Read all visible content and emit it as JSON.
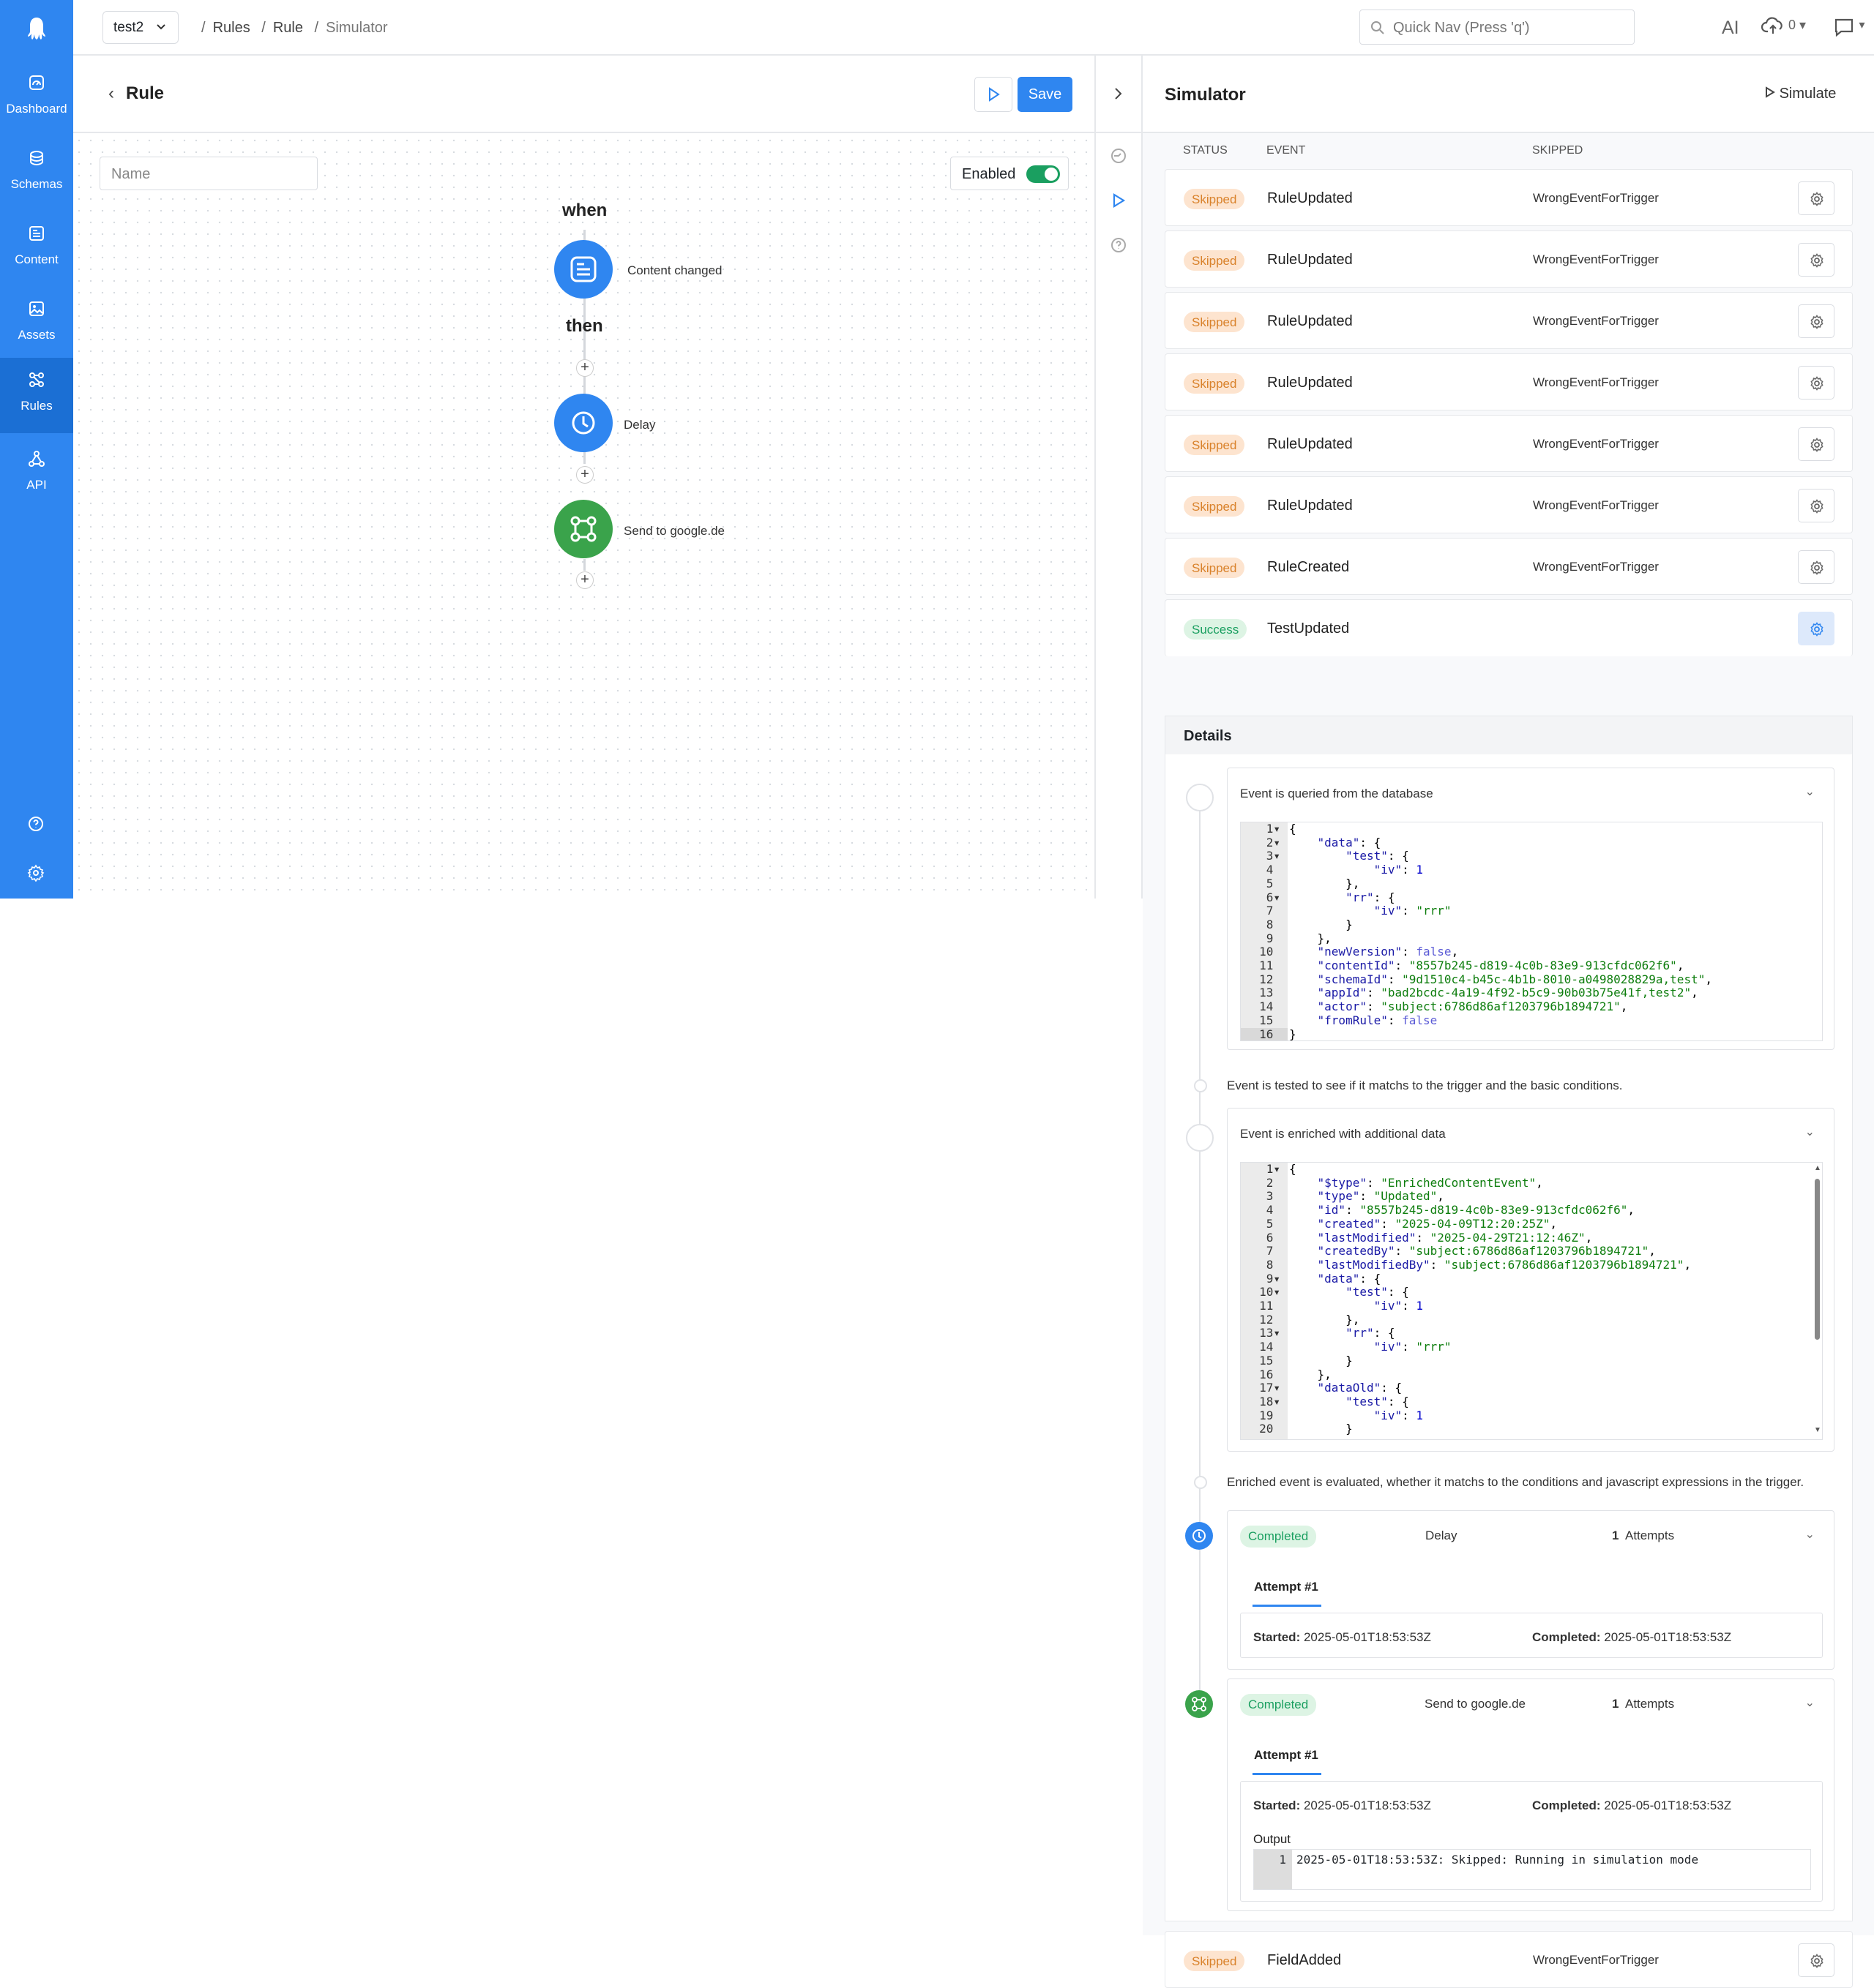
{
  "nav": {
    "items": [
      {
        "label": "Dashboard",
        "icon": "dashboard-icon"
      },
      {
        "label": "Schemas",
        "icon": "database-icon"
      },
      {
        "label": "Content",
        "icon": "content-icon"
      },
      {
        "label": "Assets",
        "icon": "image-icon"
      },
      {
        "label": "Rules",
        "icon": "rules-icon",
        "active": true
      },
      {
        "label": "API",
        "icon": "api-icon"
      }
    ]
  },
  "topbar": {
    "app": "test2",
    "breadcrumbs": [
      "Rules",
      "Rule",
      "Simulator"
    ],
    "quicknav_placeholder": "Quick Nav (Press 'q')",
    "ai": "AI",
    "upload_count": "0"
  },
  "rule": {
    "title": "Rule",
    "save_label": "Save",
    "name_placeholder": "Name",
    "enabled_label": "Enabled",
    "when_label": "when",
    "then_label": "then",
    "trigger_label": "Content changed",
    "steps": [
      "Delay",
      "Send to google.de"
    ]
  },
  "simulator": {
    "title": "Simulator",
    "simulate_label": "Simulate",
    "columns": [
      "STATUS",
      "EVENT",
      "SKIPPED"
    ],
    "events": [
      {
        "status": "Skipped",
        "event": "RuleUpdated",
        "skipped": "WrongEventForTrigger"
      },
      {
        "status": "Skipped",
        "event": "RuleUpdated",
        "skipped": "WrongEventForTrigger"
      },
      {
        "status": "Skipped",
        "event": "RuleUpdated",
        "skipped": "WrongEventForTrigger"
      },
      {
        "status": "Skipped",
        "event": "RuleUpdated",
        "skipped": "WrongEventForTrigger"
      },
      {
        "status": "Skipped",
        "event": "RuleUpdated",
        "skipped": "WrongEventForTrigger"
      },
      {
        "status": "Skipped",
        "event": "RuleUpdated",
        "skipped": "WrongEventForTrigger"
      },
      {
        "status": "Skipped",
        "event": "RuleCreated",
        "skipped": "WrongEventForTrigger"
      },
      {
        "status": "Success",
        "event": "TestUpdated",
        "skipped": ""
      }
    ],
    "last_event": {
      "status": "Skipped",
      "event": "FieldAdded",
      "skipped": "WrongEventForTrigger"
    },
    "details": {
      "title": "Details",
      "step1": "Event is queried from the database",
      "step2": "Event is tested to see if it matchs to the trigger and the basic conditions.",
      "step3": "Event is enriched with additional data",
      "step4": "Enriched event is evaluated, whether it matchs to the conditions and javascript expressions in the trigger.",
      "code1": [
        "{",
        "    \"data\": {",
        "        \"test\": {",
        "            \"iv\": 1",
        "        },",
        "        \"rr\": {",
        "            \"iv\": \"rrr\"",
        "        }",
        "    },",
        "    \"newVersion\": false,",
        "    \"contentId\": \"8557b245-d819-4c0b-83e9-913cfdc062f6\",",
        "    \"schemaId\": \"9d1510c4-b45c-4b1b-8010-a0498028829a,test\",",
        "    \"appId\": \"bad2bcdc-4a19-4f92-b5c9-90b03b75e41f,test2\",",
        "    \"actor\": \"subject:6786d86af1203796b1894721\",",
        "    \"fromRule\": false",
        "}"
      ],
      "code2": [
        "{",
        "    \"$type\": \"EnrichedContentEvent\",",
        "    \"type\": \"Updated\",",
        "    \"id\": \"8557b245-d819-4c0b-83e9-913cfdc062f6\",",
        "    \"created\": \"2025-04-09T12:20:25Z\",",
        "    \"lastModified\": \"2025-04-29T21:12:46Z\",",
        "    \"createdBy\": \"subject:6786d86af1203796b1894721\",",
        "    \"lastModifiedBy\": \"subject:6786d86af1203796b1894721\",",
        "    \"data\": {",
        "        \"test\": {",
        "            \"iv\": 1",
        "        },",
        "        \"rr\": {",
        "            \"iv\": \"rrr\"",
        "        }",
        "    },",
        "    \"dataOld\": {",
        "        \"test\": {",
        "            \"iv\": 1",
        "        }"
      ],
      "actions": [
        {
          "status": "Completed",
          "name": "Delay",
          "attempts": "1",
          "attempts_label": "Attempts",
          "tab": "Attempt  #1",
          "started_label": "Started:",
          "started": "2025-05-01T18:53:53Z",
          "completed_label": "Completed:",
          "completed": "2025-05-01T18:53:53Z"
        },
        {
          "status": "Completed",
          "name": "Send to google.de",
          "attempts": "1",
          "attempts_label": "Attempts",
          "tab": "Attempt  #1",
          "started_label": "Started:",
          "started": "2025-05-01T18:53:53Z",
          "completed_label": "Completed:",
          "completed": "2025-05-01T18:53:53Z",
          "output_label": "Output",
          "output_line_no": "1",
          "output": "2025-05-01T18:53:53Z: Skipped: Running in simulation mode"
        }
      ]
    }
  },
  "colors": {
    "primary": "#2f86f0",
    "success": "#1a9f60",
    "skipped": "#d9822b",
    "send_node": "#3aa34b"
  }
}
